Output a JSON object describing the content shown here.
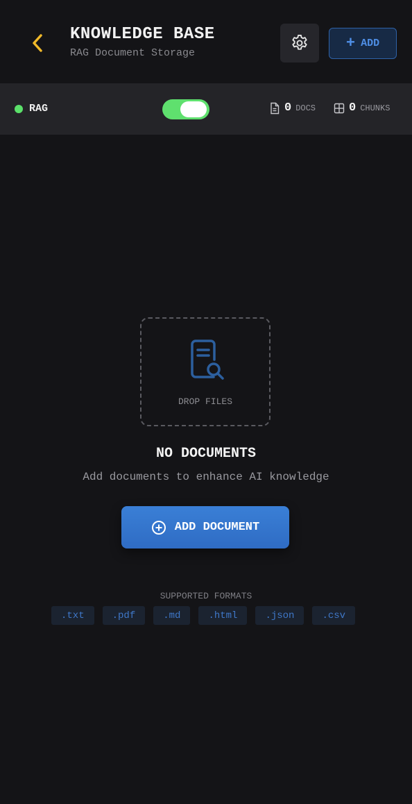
{
  "header": {
    "title": "KNOWLEDGE BASE",
    "subtitle": "RAG Document Storage",
    "add_label": "ADD",
    "back_icon": "chevron-left-icon",
    "settings_icon": "gear-icon"
  },
  "status": {
    "rag_label": "RAG",
    "rag_enabled": true,
    "docs_count": "0",
    "docs_unit": "DOCS",
    "chunks_count": "0",
    "chunks_unit": "CHUNKS"
  },
  "empty_state": {
    "drop_label": "DROP FILES",
    "title": "NO DOCUMENTS",
    "description": "Add documents to enhance AI knowledge",
    "button_label": "ADD DOCUMENT"
  },
  "formats": {
    "title": "SUPPORTED FORMATS",
    "items": [
      ".txt",
      ".pdf",
      ".md",
      ".html",
      ".json",
      ".csv"
    ]
  },
  "colors": {
    "background": "#141417",
    "accent_blue": "#3a7fd6",
    "back_arrow": "#f0b92a",
    "toggle_on": "#5fe06e",
    "status_dot": "#5be06a"
  }
}
